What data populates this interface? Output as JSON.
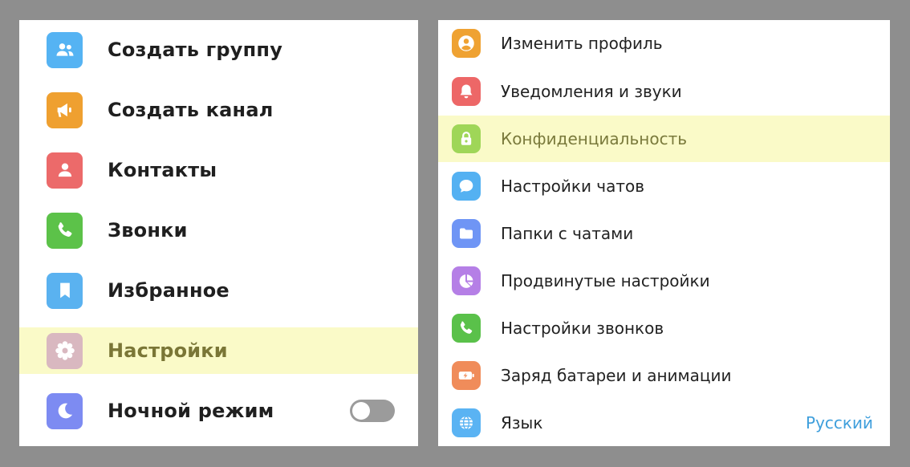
{
  "left_menu": {
    "items": [
      {
        "label": "Создать группу",
        "icon": "group-icon",
        "color": "#55b3f3"
      },
      {
        "label": "Создать канал",
        "icon": "megaphone-icon",
        "color": "#efa030"
      },
      {
        "label": "Контакты",
        "icon": "person-icon",
        "color": "#ec6a6a"
      },
      {
        "label": "Звонки",
        "icon": "phone-icon",
        "color": "#5cc249"
      },
      {
        "label": "Избранное",
        "icon": "bookmark-icon",
        "color": "#5ab2f0"
      },
      {
        "label": "Настройки",
        "icon": "gear-icon",
        "color": "#d9b8c0",
        "highlighted": true
      },
      {
        "label": "Ночной режим",
        "icon": "moon-icon",
        "color": "#7d8bf2",
        "toggle": false
      }
    ]
  },
  "settings_menu": {
    "items": [
      {
        "label": "Изменить профиль",
        "icon": "profile-icon",
        "color": "#efa232"
      },
      {
        "label": "Уведомления и звуки",
        "icon": "bell-icon",
        "color": "#ed6767"
      },
      {
        "label": "Конфиденциальность",
        "icon": "lock-icon",
        "color": "#9fd658",
        "highlighted": true
      },
      {
        "label": "Настройки чатов",
        "icon": "chat-bubble-icon",
        "color": "#54b1f2"
      },
      {
        "label": "Папки с чатами",
        "icon": "folder-icon",
        "color": "#6f95f5"
      },
      {
        "label": "Продвинутые настройки",
        "icon": "pie-chart-icon",
        "color": "#b57fe6"
      },
      {
        "label": "Настройки звонков",
        "icon": "phone-icon",
        "color": "#5ac14a"
      },
      {
        "label": "Заряд батареи и анимации",
        "icon": "battery-icon",
        "color": "#f08c5a"
      },
      {
        "label": "Язык",
        "icon": "globe-icon",
        "color": "#5ab3f3",
        "value": "Русский"
      }
    ]
  },
  "colors": {
    "highlight": "#fafac8",
    "link": "#3f9fdc",
    "toggle_off": "#9b9b9b"
  }
}
